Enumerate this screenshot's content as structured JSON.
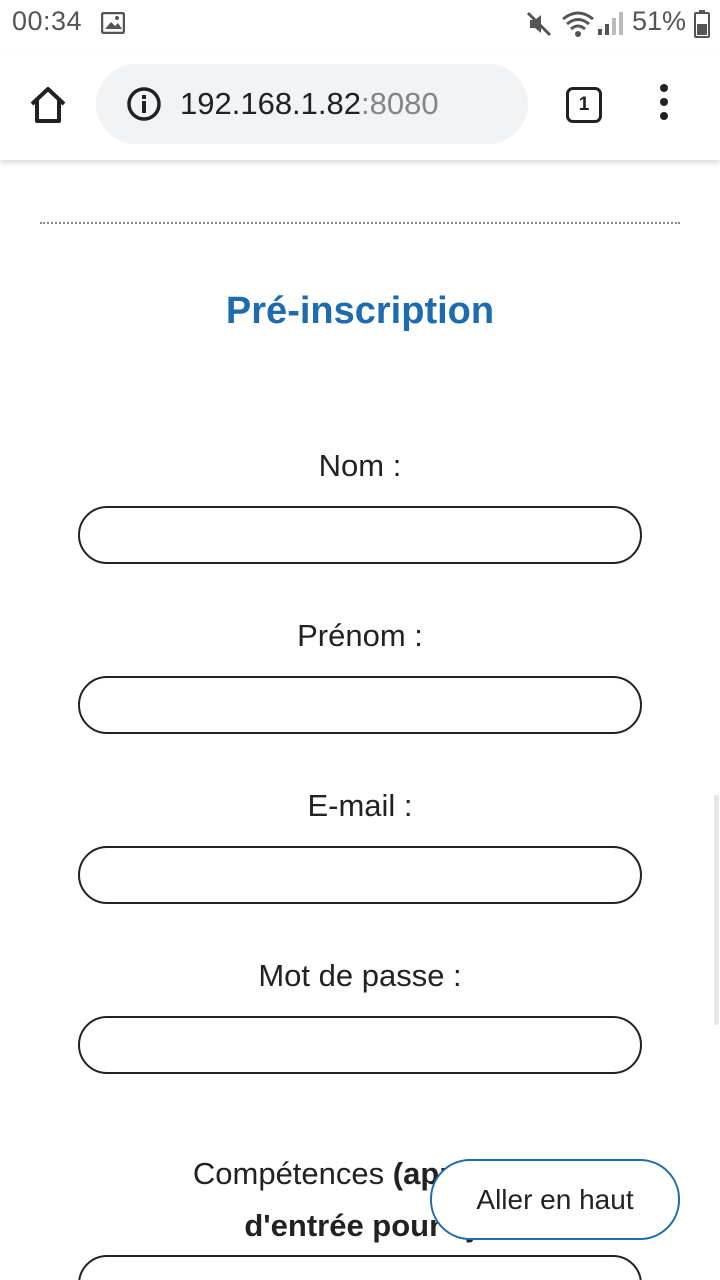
{
  "status_bar": {
    "time": "00:34",
    "battery_percent": "51%",
    "icons": [
      "gallery-icon",
      "mute-icon",
      "wifi-icon",
      "signal-icon",
      "battery-icon"
    ]
  },
  "browser": {
    "url_host": "192.168.1.82",
    "url_port": ":8080",
    "tab_count": "1",
    "icons": [
      "home-icon",
      "info-icon",
      "tabs-icon",
      "more-menu-icon"
    ]
  },
  "page": {
    "title": "Pré-inscription",
    "fields": [
      {
        "label": "Nom :",
        "value": ""
      },
      {
        "label": "Prénom :",
        "value": ""
      },
      {
        "label": "E-mail :",
        "value": ""
      },
      {
        "label": "Mot de passe :",
        "value": ""
      }
    ],
    "competences": {
      "label_regular": "Compétences ",
      "label_bold_1": "(appuyez",
      "label_bold_2": "d'entrée pour aj",
      "value": ""
    },
    "back_to_top": "Aller en haut"
  },
  "colors": {
    "accent": "#1e6bad",
    "text": "#222222",
    "url_bar_bg": "#f1f3f4"
  }
}
